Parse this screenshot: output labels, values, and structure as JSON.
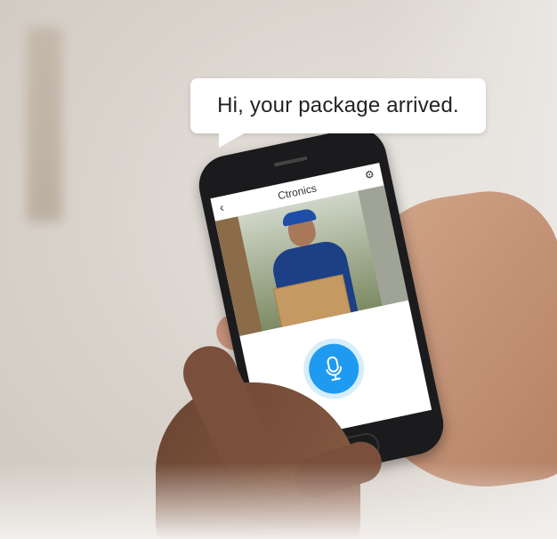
{
  "speech_bubble": {
    "text": "Hi, your package arrived."
  },
  "app": {
    "title": "Ctronics",
    "back_icon": "chevron-left-icon",
    "settings_icon": "gear-icon",
    "mic_icon": "microphone-icon",
    "accent_color": "#1e9af0"
  }
}
